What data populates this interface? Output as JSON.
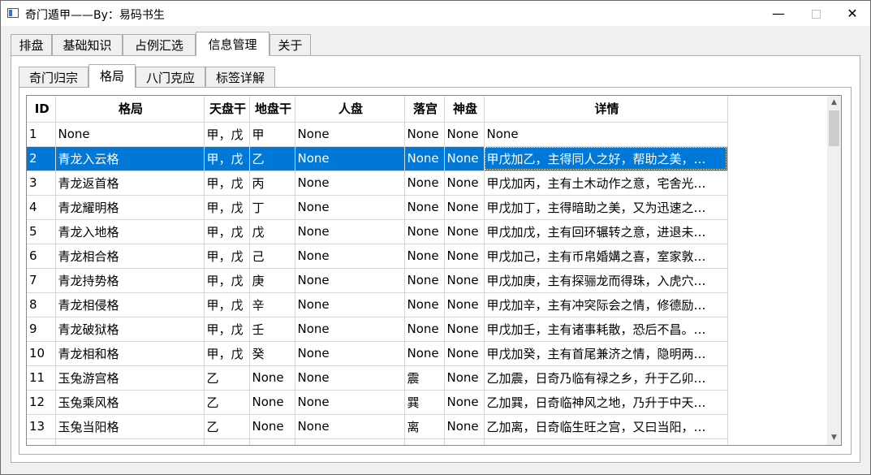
{
  "window": {
    "title": "奇门遁甲——By：易码书生",
    "minimize": "—",
    "close": "✕"
  },
  "outer_tabs": [
    "排盘",
    "基础知识",
    "占例汇选",
    "信息管理",
    "关于"
  ],
  "outer_active": "信息管理",
  "inner_tabs": [
    "奇门归宗",
    "格局",
    "八门克应",
    "标签详解"
  ],
  "inner_active": "格局",
  "table": {
    "headers": [
      "ID",
      "格局",
      "天盘干",
      "地盘干",
      "人盘",
      "落宫",
      "神盘",
      "详情"
    ],
    "selected_id": "2",
    "rows": [
      [
        "1",
        "None",
        "甲，戊",
        "甲",
        "None",
        "None",
        "None",
        "None"
      ],
      [
        "2",
        "青龙入云格",
        "甲，戊",
        "乙",
        "None",
        "None",
        "None",
        "甲戊加乙，主得同人之好，帮助之美，…"
      ],
      [
        "3",
        "青龙返首格",
        "甲，戊",
        "丙",
        "None",
        "None",
        "None",
        "甲戊加丙，主有土木动作之意，宅舍光…"
      ],
      [
        "4",
        "青龙耀明格",
        "甲，戊",
        "丁",
        "None",
        "None",
        "None",
        "甲戊加丁，主得暗助之美，又为迅速之…"
      ],
      [
        "5",
        "青龙入地格",
        "甲，戊",
        "戊",
        "None",
        "None",
        "None",
        "甲戊加戊，主有回环辗转之意，进退未…"
      ],
      [
        "6",
        "青龙相合格",
        "甲，戊",
        "己",
        "None",
        "None",
        "None",
        "甲戊加己，主有币帛婚媾之喜，室家敦…"
      ],
      [
        "7",
        "青龙持势格",
        "甲，戊",
        "庚",
        "None",
        "None",
        "None",
        "甲戊加庚，主有探骊龙而得珠，入虎穴…"
      ],
      [
        "8",
        "青龙相侵格",
        "甲，戊",
        "辛",
        "None",
        "None",
        "None",
        "甲戊加辛，主有冲突际会之情，修德励…"
      ],
      [
        "9",
        "青龙破狱格",
        "甲，戊",
        "壬",
        "None",
        "None",
        "None",
        "甲戊加壬，主有诸事耗散，恐后不昌。…"
      ],
      [
        "10",
        "青龙相和格",
        "甲，戊",
        "癸",
        "None",
        "None",
        "None",
        "甲戊加癸，主有首尾兼济之情，隐明两…"
      ],
      [
        "11",
        "玉兔游宫格",
        "乙",
        "None",
        "None",
        "震",
        "None",
        "乙加震，日奇乃临有禄之乡，升于乙卯…"
      ],
      [
        "12",
        "玉兔乘风格",
        "乙",
        "None",
        "None",
        "巽",
        "None",
        "乙加巽，日奇临神风之地，乃升于中天…"
      ],
      [
        "13",
        "玉兔当阳格",
        "乙",
        "None",
        "None",
        "离",
        "None",
        "乙加离，日奇临生旺之宫，又曰当阳，…"
      ]
    ]
  }
}
